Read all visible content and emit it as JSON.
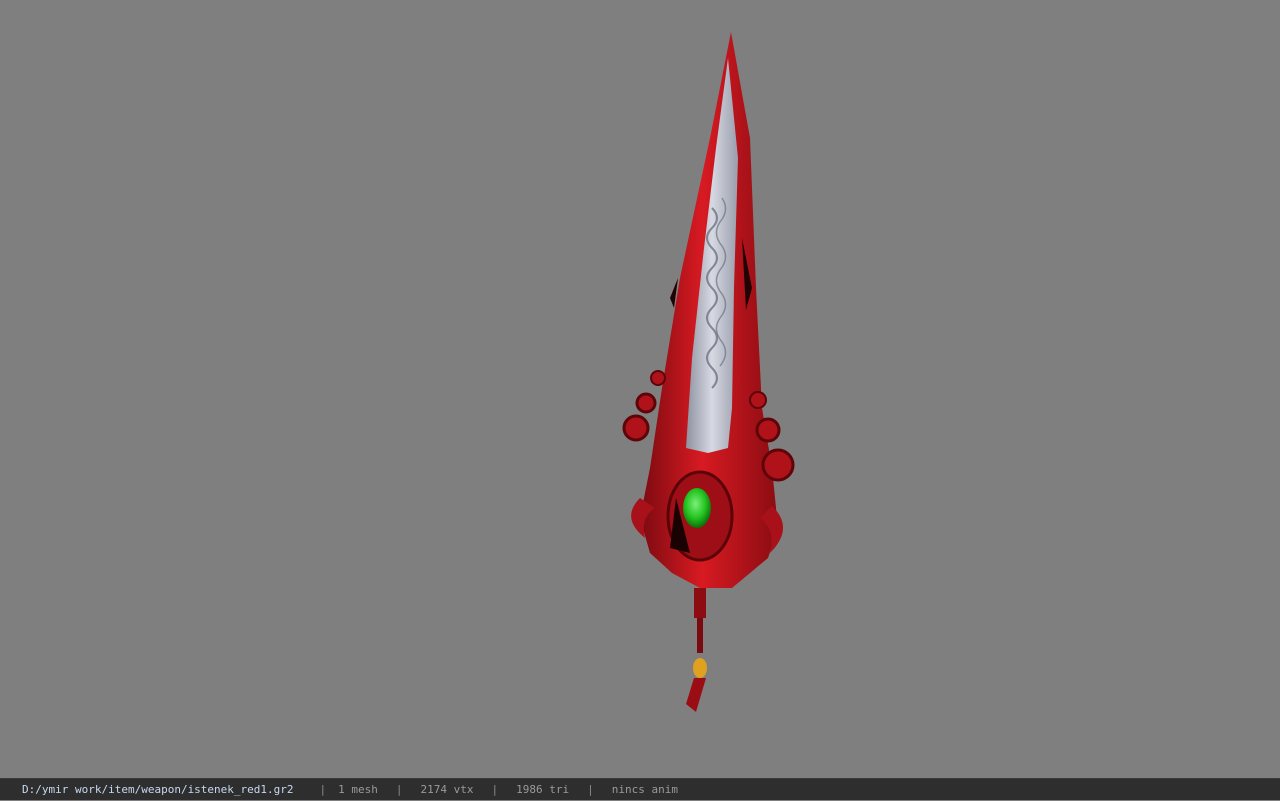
{
  "viewer": {
    "background": "#7f7f7f",
    "model_name": "istenek_red1"
  },
  "statusbar": {
    "file_path": "D:/ymir work/item/weapon/istenek_red1.gr2",
    "mesh_count": "1 mesh",
    "vertex_count": "2174 vtx",
    "triangle_count": "1986 tri",
    "animation": "nincs anim",
    "separator": "|"
  },
  "colors": {
    "blade_red": "#c0141c",
    "blade_steel": "#b8bcc8",
    "gem_green": "#22c21e",
    "statusbar_bg": "#2e2e2e",
    "path_text": "#c8d8f0"
  }
}
